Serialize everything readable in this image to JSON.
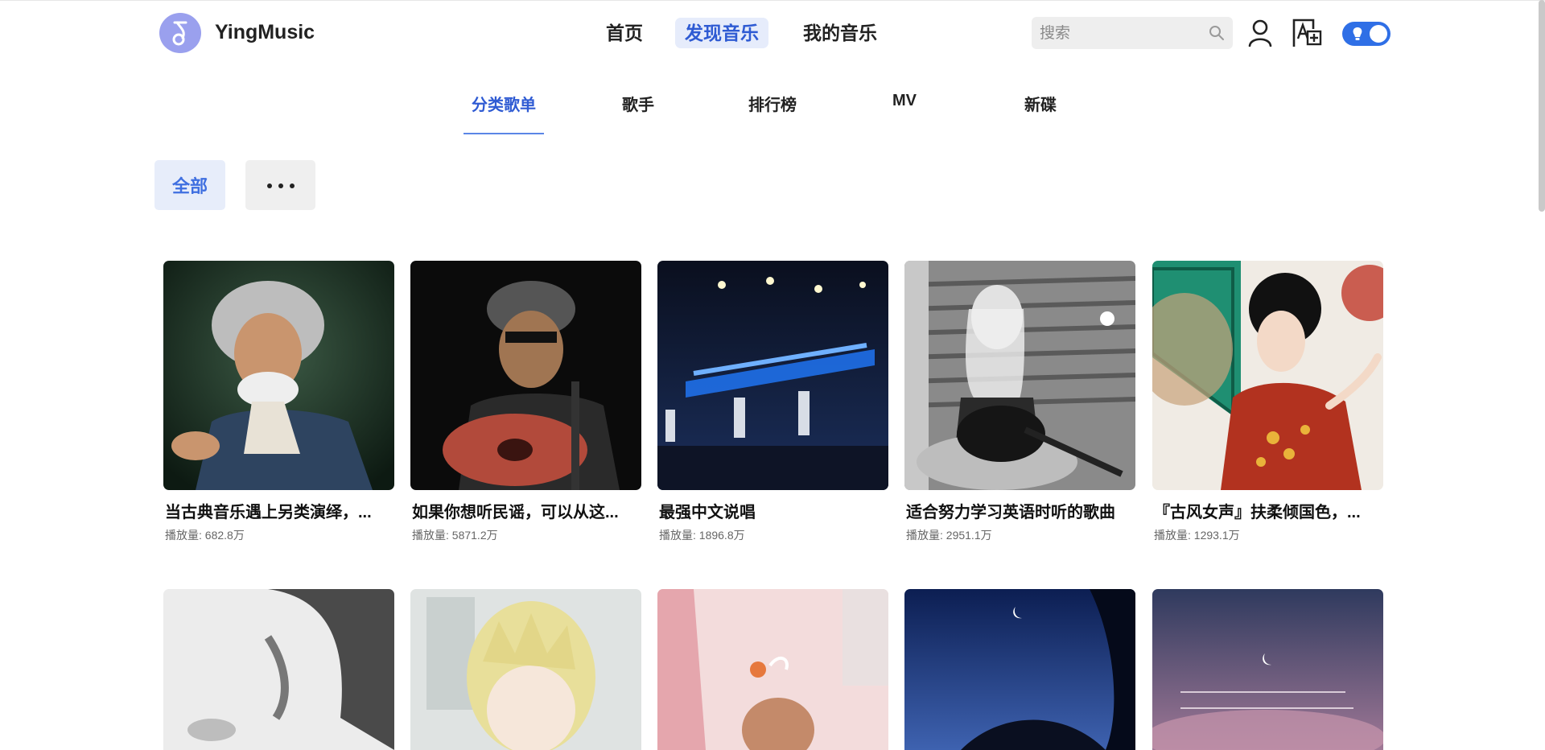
{
  "brand": {
    "name": "YingMusic"
  },
  "nav": {
    "items": [
      "首页",
      "发现音乐",
      "我的音乐"
    ],
    "active": "发现音乐"
  },
  "search": {
    "placeholder": "搜索"
  },
  "icons": {
    "search": "search-icon",
    "user": "user-icon",
    "translate": "translate-icon",
    "theme": "theme-toggle"
  },
  "subtabs": {
    "items": [
      "分类歌单",
      "歌手",
      "排行榜",
      "MV",
      "新碟"
    ],
    "active": "分类歌单"
  },
  "filters": {
    "all": "全部",
    "more": "more-icon"
  },
  "colors": {
    "accent": "#2f5bd3",
    "active_bg": "#e6ecfb",
    "toggle": "#2f6fe6"
  },
  "playlists": [
    {
      "title": "当古典音乐遇上另类演绎，...",
      "plays": "播放量: 682.8万"
    },
    {
      "title": "如果你想听民谣，可以从这...",
      "plays": "播放量: 5871.2万"
    },
    {
      "title": "最强中文说唱",
      "plays": "播放量: 1896.8万"
    },
    {
      "title": "适合努力学习英语时听的歌曲",
      "plays": "播放量: 2951.1万"
    },
    {
      "title": "『古风女声』扶柔倾国色，...",
      "plays": "播放量: 1293.1万"
    }
  ]
}
